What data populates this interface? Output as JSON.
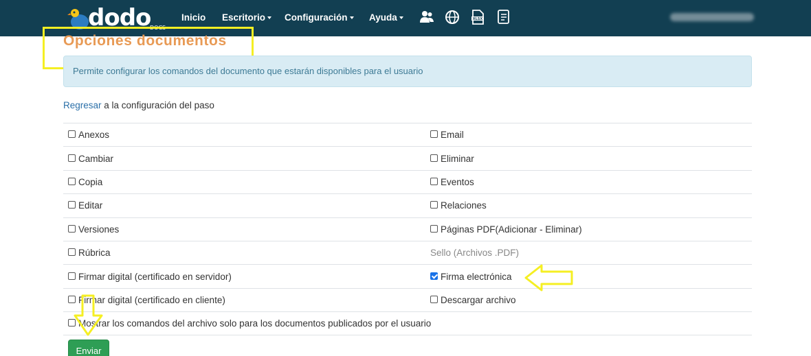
{
  "navbar": {
    "brand": "dodo",
    "brand_sub": "DOCS",
    "items": [
      {
        "label": "Inicio"
      },
      {
        "label": "Escritorio"
      },
      {
        "label": "Configuración"
      },
      {
        "label": "Ayuda"
      }
    ],
    "icons": [
      "users-icon",
      "globe-icon",
      "xlsx-file-icon",
      "document-list-icon"
    ]
  },
  "page": {
    "title": "Opciones documentos",
    "info": "Permite configurar los comandos del documento que estarán disponibles para el usuario",
    "back_link": "Regresar",
    "back_rest": " a la configuración del paso"
  },
  "options": {
    "rows": [
      {
        "left": "Anexos",
        "right": "Email"
      },
      {
        "left": "Cambiar",
        "right": "Eliminar"
      },
      {
        "left": "Copia",
        "right": "Eventos"
      },
      {
        "left": "Editar",
        "right": "Relaciones"
      },
      {
        "left": "Versiones",
        "right": "Páginas PDF(Adicionar - Eliminar)"
      },
      {
        "left": "Rúbrica",
        "right": "Sello (Archivos .PDF)"
      },
      {
        "left": "Firmar digital (certificado en servidor)",
        "right": "Firma electrónica"
      },
      {
        "left": "Firmar digital (certificado en cliente)",
        "right": "Descargar archivo"
      },
      {
        "left": "Mostrar los comandos del archivo solo para los documentos publicados por el usuario"
      }
    ],
    "checked": [
      "Firma electrónica"
    ],
    "disabled": [
      "Sello (Archivos .PDF)"
    ]
  },
  "submit_label": "Enviar",
  "colors": {
    "navbar": "#123f52",
    "title": "#e89a55",
    "info_bg": "#d9ecf4",
    "link": "#2a6fa8",
    "submit": "#2e9e55",
    "annotation": "#f5ef23"
  }
}
